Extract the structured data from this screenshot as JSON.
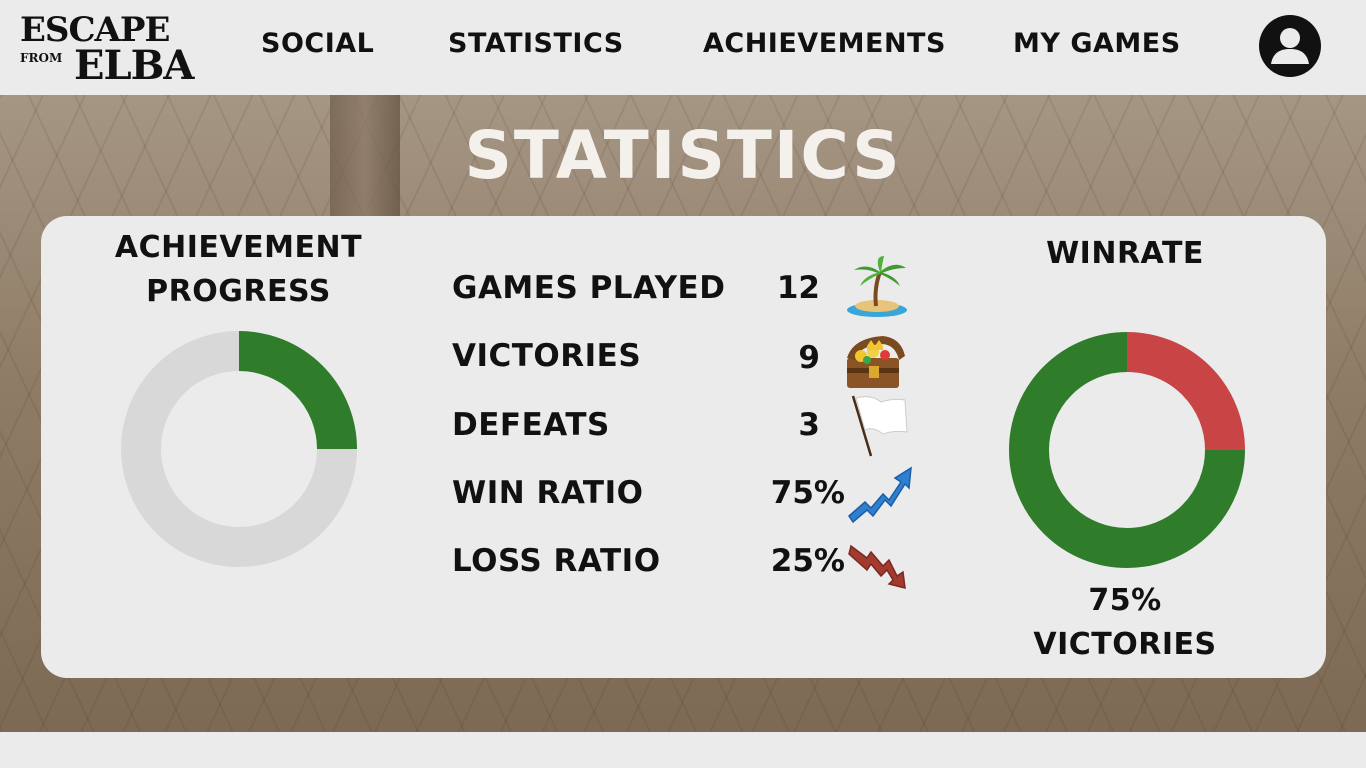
{
  "header": {
    "logo": {
      "line1": "ESCAPE",
      "line2": "FROM",
      "line3": "ELBA"
    },
    "nav": [
      {
        "label": "SOCIAL"
      },
      {
        "label": "STATISTICS"
      },
      {
        "label": "ACHIEVEMENTS"
      },
      {
        "label": "MY GAMES"
      }
    ],
    "avatar_icon": "user-avatar-icon"
  },
  "page": {
    "title": "STATISTICS"
  },
  "achievements": {
    "title_line1": "ACHIEVEMENT",
    "title_line2": "PROGRESS",
    "progress_fraction": 0.25,
    "progress_color": "#2f7d2a",
    "track_color": "#d8d8d8"
  },
  "stats": [
    {
      "label": "GAMES PLAYED",
      "value": "12",
      "icon": "palm-island-icon"
    },
    {
      "label": "VICTORIES",
      "value": "9",
      "icon": "treasure-chest-icon"
    },
    {
      "label": "DEFEATS",
      "value": "3",
      "icon": "white-flag-icon"
    },
    {
      "label": "WIN RATIO",
      "value": "75%",
      "icon": "trend-up-arrow-icon"
    },
    {
      "label": "LOSS RATIO",
      "value": "25%",
      "icon": "trend-down-arrow-icon"
    }
  ],
  "winrate": {
    "title": "WINRATE",
    "caption_line1": "75%",
    "caption_line2": "VICTORIES",
    "victories_fraction": 0.75,
    "victory_color": "#2f7d2a",
    "defeat_color": "#c94545"
  },
  "colors": {
    "background": "#ebebeb",
    "card": "#ebebeb",
    "title_text": "#f4f1ec",
    "scene": "#8f7c66"
  }
}
